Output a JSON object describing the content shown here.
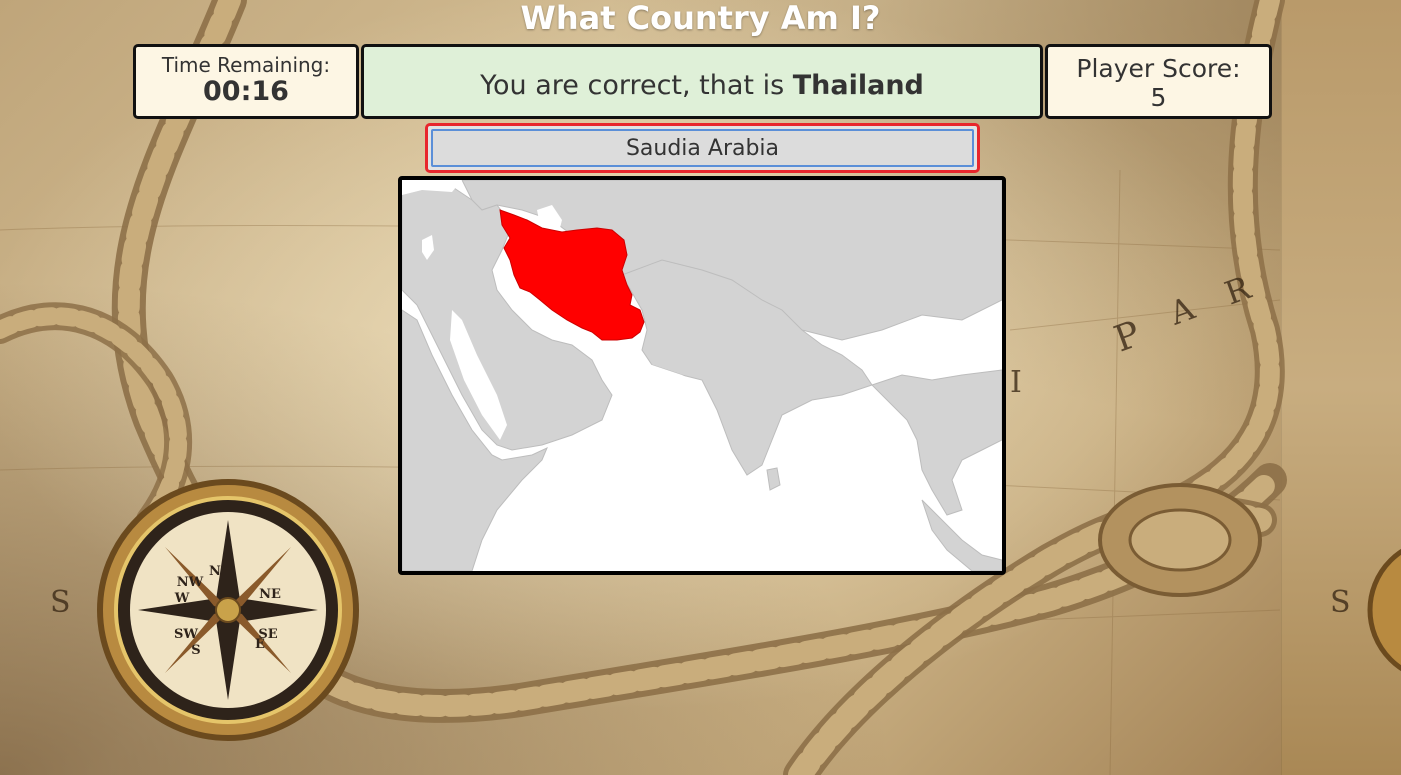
{
  "header": {
    "title": "What Country Am I?"
  },
  "timer": {
    "label": "Time Remaining:",
    "value": "00:16"
  },
  "feedback": {
    "prefix": "You are correct, that is ",
    "country": "Thailand",
    "color": "#dff0d8"
  },
  "score": {
    "label": "Player Score:",
    "value": "5"
  },
  "answer": {
    "value": "Saudia Arabia"
  },
  "map": {
    "highlight_color": "#ff0000",
    "land_color": "#d3d3d3",
    "sea_color": "#ffffff"
  },
  "background": {
    "compass_labels": [
      "NE",
      "SE",
      "SW",
      "NW",
      "N",
      "E",
      "S",
      "W"
    ],
    "map_letters": [
      "P",
      "A",
      "R",
      "I",
      "S"
    ]
  }
}
